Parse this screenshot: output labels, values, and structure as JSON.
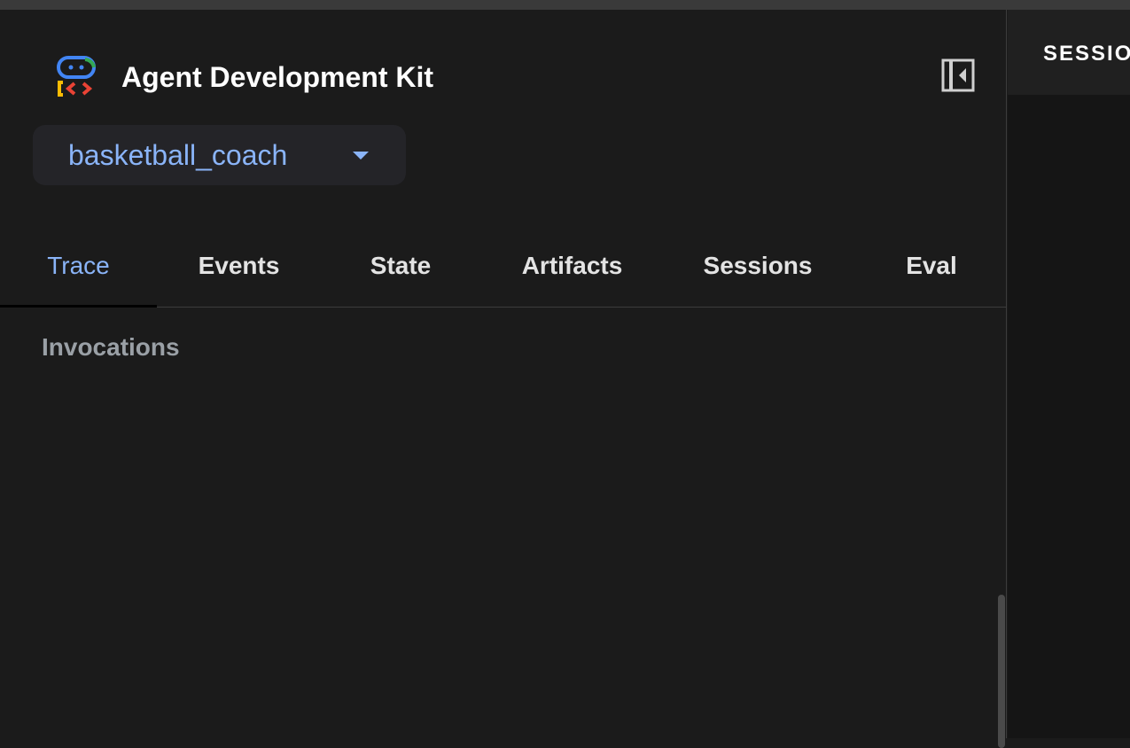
{
  "app": {
    "title": "Agent Development Kit",
    "logo_icon": "adk-robot-logo",
    "colors": {
      "accent": "#8ab4f8",
      "background": "#1b1b1b",
      "logo_blue": "#4285f4",
      "logo_green": "#34a853",
      "logo_yellow": "#fbbc04",
      "logo_red": "#ea4335"
    }
  },
  "sidebar": {
    "collapse_icon": "collapse-sidebar-icon",
    "agent_selector": {
      "value": "basketball_coach",
      "icon": "dropdown-arrow-icon"
    },
    "tabs": [
      {
        "label": "Trace",
        "active": true
      },
      {
        "label": "Events",
        "active": false
      },
      {
        "label": "State",
        "active": false
      },
      {
        "label": "Artifacts",
        "active": false
      },
      {
        "label": "Sessions",
        "active": false
      },
      {
        "label": "Eval",
        "active": false
      }
    ],
    "section_heading": "Invocations"
  },
  "main": {
    "header_label": "SESSIO"
  }
}
